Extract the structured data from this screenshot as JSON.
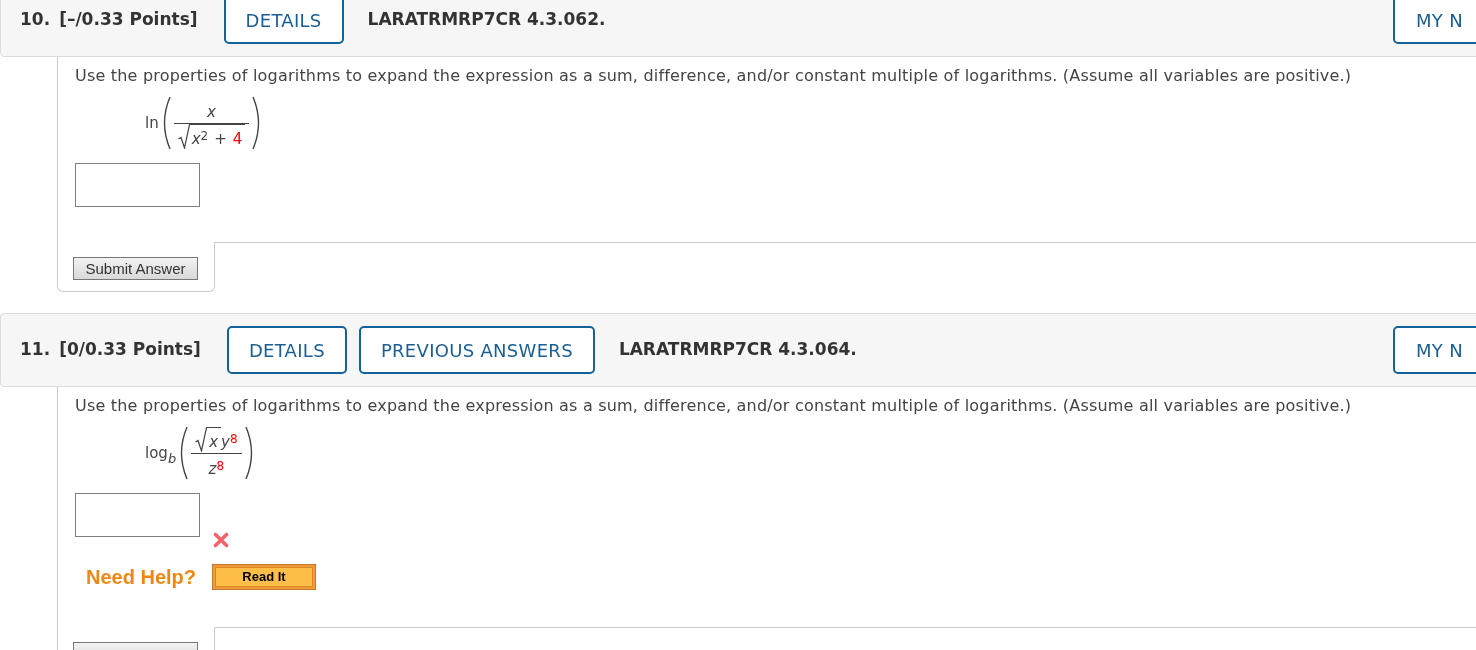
{
  "questions": [
    {
      "number": "10.",
      "points": "[–/0.33 Points]",
      "header_buttons": [
        "DETAILS"
      ],
      "code": "LARATRMRP7CR 4.3.062.",
      "notes_button": "MY N",
      "instruction": "Use the properties of logarithms to expand the expression as a sum, difference, and/or constant multiple of logarithms. (Assume all variables are positive.)",
      "expression": {
        "function": "ln",
        "numerator": [
          {
            "kind": "plain",
            "terms": [
              {
                "kind": "var",
                "text": "x",
                "highlighted": false
              }
            ]
          }
        ],
        "denominator": [
          {
            "kind": "sqrt",
            "terms": [
              {
                "kind": "var",
                "text": "x",
                "highlighted": false
              },
              {
                "kind": "sup",
                "text": "2",
                "highlighted": false
              },
              {
                "kind": "op",
                "text": "+",
                "highlighted": false
              },
              {
                "kind": "num",
                "text": "4",
                "highlighted": true
              }
            ]
          }
        ]
      },
      "submit": {
        "shown": true,
        "label": "Submit Answer"
      }
    },
    {
      "number": "11.",
      "points": "[0/0.33 Points]",
      "header_buttons": [
        "DETAILS",
        "PREVIOUS ANSWERS"
      ],
      "code": "LARATRMRP7CR 4.3.064.",
      "notes_button": "MY N",
      "instruction": "Use the properties of logarithms to expand the expression as a sum, difference, and/or constant multiple of logarithms. (Assume all variables are positive.)",
      "expression": {
        "function": "log",
        "base": "b",
        "numerator": [
          {
            "kind": "sqrt",
            "terms": [
              {
                "kind": "var",
                "text": "x",
                "highlighted": false
              }
            ]
          },
          {
            "kind": "plain",
            "terms": [
              {
                "kind": "var",
                "text": "y",
                "highlighted": false
              },
              {
                "kind": "sup",
                "text": "8",
                "highlighted": true
              }
            ]
          }
        ],
        "denominator": [
          {
            "kind": "plain",
            "terms": [
              {
                "kind": "var",
                "text": "z",
                "highlighted": false
              },
              {
                "kind": "sup",
                "text": "8",
                "highlighted": true
              }
            ]
          }
        ]
      },
      "answer": {
        "correct": false
      },
      "help": {
        "label": "Need Help?",
        "button": "Read It"
      },
      "submit": {
        "shown": true
      }
    }
  ]
}
